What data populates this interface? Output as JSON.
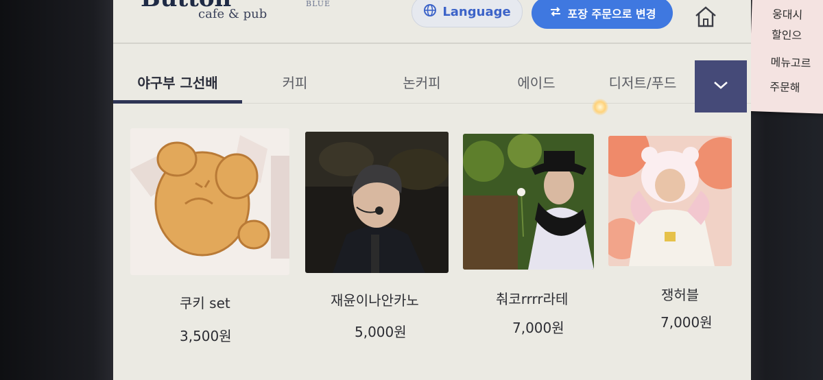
{
  "header": {
    "logo_main": "Button",
    "logo_brand_suffix": "BLUE",
    "logo_sub": "cafe & pub",
    "language_label": "Language",
    "order_label": "포장 주문으로 변경"
  },
  "tabs": [
    {
      "label": "야구부 그선배",
      "active": true
    },
    {
      "label": "커피",
      "active": false
    },
    {
      "label": "논커피",
      "active": false
    },
    {
      "label": "에이드",
      "active": false
    },
    {
      "label": "디저트/푸드",
      "active": false
    }
  ],
  "products": [
    {
      "name": "쿠키 set",
      "price": "3,500원"
    },
    {
      "name": "재윤이나안카노",
      "price": "5,000원"
    },
    {
      "name": "춰코rrrr라테",
      "price": "7,000원"
    },
    {
      "name": "쟁허블",
      "price": "7,000원"
    }
  ],
  "note_lines": [
    "웅대시",
    "할인으",
    "메뉴고르",
    "주문해"
  ],
  "colors": {
    "accent_blue": "#3f78e0",
    "tab_underline": "#2e3555",
    "more_button": "#454a78"
  },
  "icons": [
    "globe-icon",
    "swap-icon",
    "home-icon",
    "chevron-down-icon"
  ]
}
